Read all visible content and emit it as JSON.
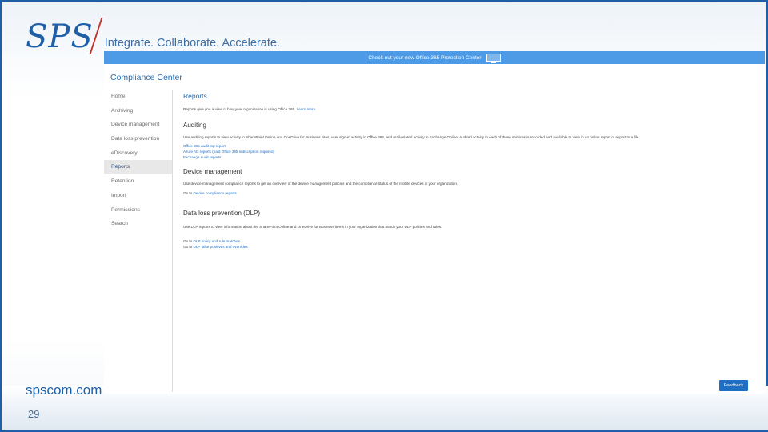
{
  "slide": {
    "logo_text": "SPS",
    "tagline": "Integrate. Collaborate. Accelerate.",
    "website": "spscom.com",
    "slide_number": "29",
    "colors": {
      "brand": "#1f5fa6",
      "accent": "#c2342c",
      "banner": "#4d9be6",
      "link": "#1f6fc5"
    }
  },
  "app": {
    "banner_text": "Check out your new Office 365 Protection Center",
    "banner_icon": "monitor-icon",
    "title": "Compliance Center",
    "nav": [
      {
        "label": "Home"
      },
      {
        "label": "Archiving"
      },
      {
        "label": "Device management"
      },
      {
        "label": "Data loss prevention"
      },
      {
        "label": "eDiscovery"
      },
      {
        "label": "Reports",
        "active": true
      },
      {
        "label": "Retention"
      },
      {
        "label": "Import"
      },
      {
        "label": "Permissions"
      },
      {
        "label": "Search"
      }
    ],
    "page": {
      "heading": "Reports",
      "intro": "Reports give you a view of how your organization is using Office 365.",
      "intro_link": "Learn more",
      "auditing": {
        "heading": "Auditing",
        "desc": "Use auditing reports to view activity in SharePoint Online and OneDrive for Business sites, user sign-in activity in Office 365, and mail-related activity in Exchange Online. Audited activity in each of these services is recorded and available to view in an online report or export to a file.",
        "links": [
          "Office 365 audit log report",
          "Azure AD reports (paid Office 365 subscription required)",
          "Exchange audit reports"
        ]
      },
      "device": {
        "heading": "Device management",
        "desc": "Use device management compliance reports to get an overview of the device management policies and the compliance status of the mobile devices in your organization.",
        "goto_prefix": "Go to",
        "link": "Device compliance reports"
      },
      "dlp": {
        "heading": "Data loss prevention (DLP)",
        "desc": "Use DLP reports to view information about the SharePoint Online and OneDrive for Business items in your organization that match your DLP policies and rules.",
        "goto_prefix": "Go to",
        "link1": "DLP policy and rule matches",
        "link2": "DLP false positives and overrides"
      }
    },
    "feedback_label": "Feedback"
  }
}
